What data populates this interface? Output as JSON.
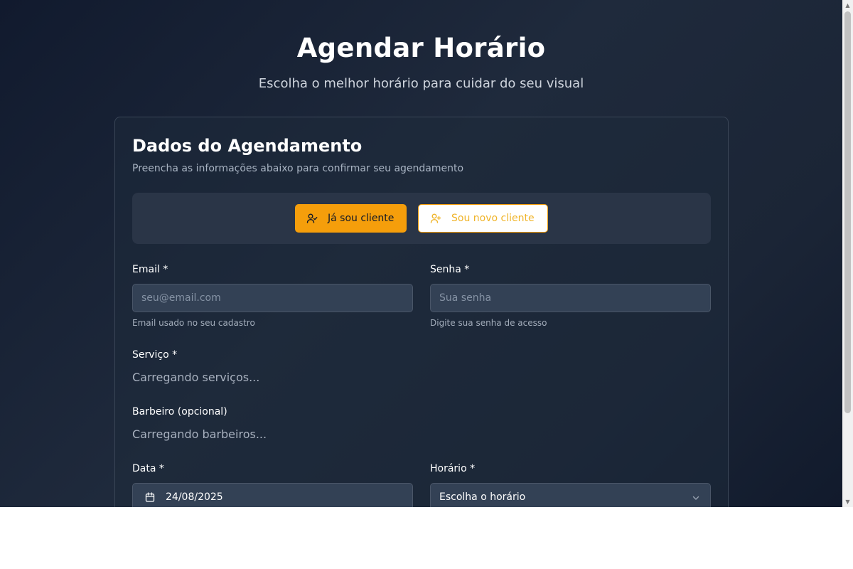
{
  "header": {
    "title": "Agendar Horário",
    "subtitle": "Escolha o melhor horário para cuidar do seu visual"
  },
  "card": {
    "title": "Dados do Agendamento",
    "description": "Preencha as informações abaixo para confirmar seu agendamento"
  },
  "client_toggle": {
    "existing_label": "Já sou cliente",
    "existing_icon": "user-check-icon",
    "new_label": "Sou novo cliente",
    "new_icon": "user-plus-icon",
    "selected": "existing"
  },
  "form": {
    "email": {
      "label": "Email *",
      "placeholder": "seu@email.com",
      "value": "",
      "hint": "Email usado no seu cadastro"
    },
    "password": {
      "label": "Senha *",
      "placeholder": "Sua senha",
      "value": "",
      "hint": "Digite sua senha de acesso"
    },
    "service": {
      "label": "Serviço *",
      "status": "Carregando serviços..."
    },
    "barber": {
      "label": "Barbeiro (opcional)",
      "status": "Carregando barbeiros..."
    },
    "date": {
      "label": "Data *",
      "value": "24/08/2025",
      "icon": "calendar-icon"
    },
    "time": {
      "label": "Horário *",
      "value": "Escolha o horário",
      "icon": "chevron-down-icon"
    }
  },
  "colors": {
    "accent": "#f59e0b",
    "background": "#1e293b",
    "input_background": "#334155"
  }
}
